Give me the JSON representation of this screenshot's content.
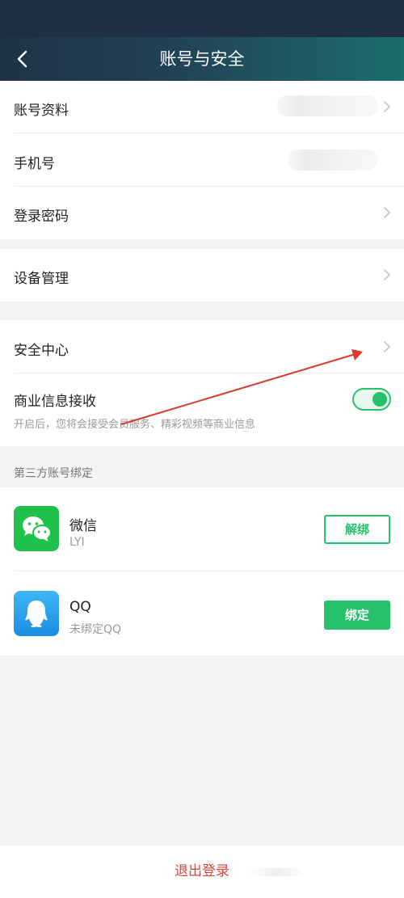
{
  "nav": {
    "title": "账号与安全"
  },
  "account": {
    "profile_label": "账号资料",
    "phone_label": "手机号",
    "password_label": "登录密码"
  },
  "devices": {
    "label": "设备管理"
  },
  "security": {
    "center_label": "安全中心",
    "business_label": "商业信息接收",
    "business_desc": "开启后，您将会接受会员服务、精彩视频等商业信息",
    "business_enabled": true
  },
  "third_party": {
    "header": "第三方账号绑定",
    "items": [
      {
        "name": "微信",
        "sub": "LYI",
        "button": "解绑"
      },
      {
        "name": "QQ",
        "sub": "未绑定QQ",
        "button": "绑定"
      }
    ]
  },
  "logout": {
    "label": "退出登录"
  },
  "colors": {
    "accent": "#25c26b",
    "danger": "#d9453a",
    "annotation": "#d93a2e"
  }
}
